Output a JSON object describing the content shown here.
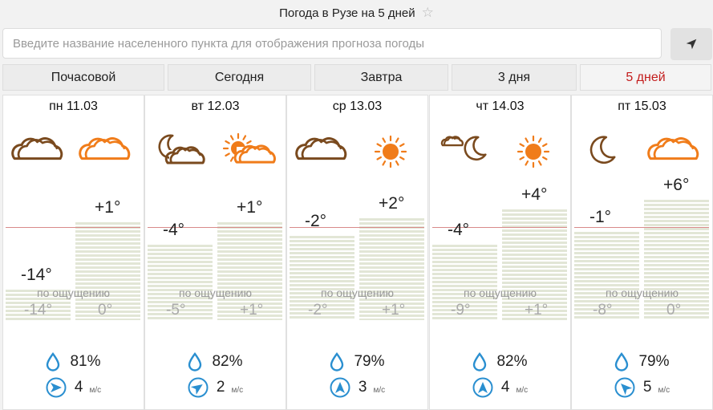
{
  "header": {
    "title": "Погода в Рузе на 5 дней",
    "star_icon": "star-outline-icon"
  },
  "search": {
    "placeholder": "Введите название населенного пункта для отображения прогноза погоды",
    "value": "",
    "locate_icon": "location-arrow-icon"
  },
  "tabs": [
    {
      "label": "Почасовой",
      "active": false
    },
    {
      "label": "Сегодня",
      "active": false
    },
    {
      "label": "Завтра",
      "active": false
    },
    {
      "label": "3 дня",
      "active": false
    },
    {
      "label": "5 дней",
      "active": true
    }
  ],
  "feels_label": "по ощущению",
  "wind_unit": "м/с",
  "colors": {
    "accent": "#c31c1c",
    "icon_orange": "#f07c1a",
    "icon_brown": "#7a4a1e",
    "drop_blue": "#2a8fd0"
  },
  "days": [
    {
      "date": "пн 11.03",
      "night_icon": "cloud-icon",
      "day_icon": "cloud-icon",
      "night_temp": "-14°",
      "day_temp": "+1°",
      "night_feel": "-14°",
      "day_feel": "0°",
      "humidity": "81%",
      "wind_speed": "4",
      "wind_direction": "west"
    },
    {
      "date": "вт 12.03",
      "night_icon": "moon-cloud-icon",
      "day_icon": "sun-cloud-icon",
      "night_temp": "-4°",
      "day_temp": "+1°",
      "night_feel": "-5°",
      "day_feel": "+1°",
      "humidity": "82%",
      "wind_speed": "2",
      "wind_direction": "northwest"
    },
    {
      "date": "ср 13.03",
      "night_icon": "cloud-icon",
      "day_icon": "sun-icon",
      "night_temp": "-2°",
      "day_temp": "+2°",
      "night_feel": "-2°",
      "day_feel": "+1°",
      "humidity": "79%",
      "wind_speed": "3",
      "wind_direction": "south"
    },
    {
      "date": "чт 14.03",
      "night_icon": "moon-small-cloud-icon",
      "day_icon": "sun-icon",
      "night_temp": "-4°",
      "day_temp": "+4°",
      "night_feel": "-9°",
      "day_feel": "+1°",
      "humidity": "82%",
      "wind_speed": "4",
      "wind_direction": "south"
    },
    {
      "date": "пт 15.03",
      "night_icon": "moon-icon",
      "day_icon": "cloud-icon",
      "night_temp": "-1°",
      "day_temp": "+6°",
      "night_feel": "-8°",
      "day_feel": "0°",
      "humidity": "79%",
      "wind_speed": "5",
      "wind_direction": "southwest"
    }
  ]
}
